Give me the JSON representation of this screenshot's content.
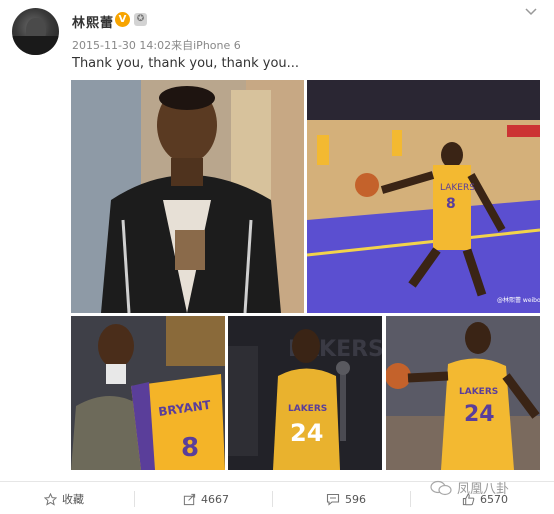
{
  "user": {
    "name": "林熙蕾",
    "verified_badge": "V",
    "medal_icon": "medal-icon"
  },
  "post": {
    "timestamp": "2015-11-30 14:02",
    "source": "来自iPhone 6",
    "text": "Thank you, thank you, thank you..."
  },
  "images": [
    {
      "name": "photo-young-kobe",
      "alt": "young player portrait"
    },
    {
      "name": "photo-lakers-dunk",
      "alt": "Lakers #8 dunk"
    },
    {
      "name": "photo-draft-jersey",
      "alt": "holding BRYANT 8 jersey"
    },
    {
      "name": "photo-24-trophy",
      "alt": "Lakers #24 with trophy"
    },
    {
      "name": "photo-24-dribble",
      "alt": "Lakers #24 dribbling"
    }
  ],
  "photo_text": {
    "jersey_name": "BRYANT",
    "jersey_number_8": "8",
    "jersey_number_24": "24",
    "team": "LAKERS",
    "watermark": "@林熙蕾 weibo.com/linxilei"
  },
  "actions": {
    "favorite_label": "收藏",
    "forward_count": "4667",
    "comment_count": "596",
    "like_count": "6570"
  },
  "brand": {
    "name": "凤凰八卦"
  },
  "colors": {
    "badge": "#f7a400",
    "lakers_gold": "#f3b931",
    "lakers_purple": "#5a3e9a"
  }
}
